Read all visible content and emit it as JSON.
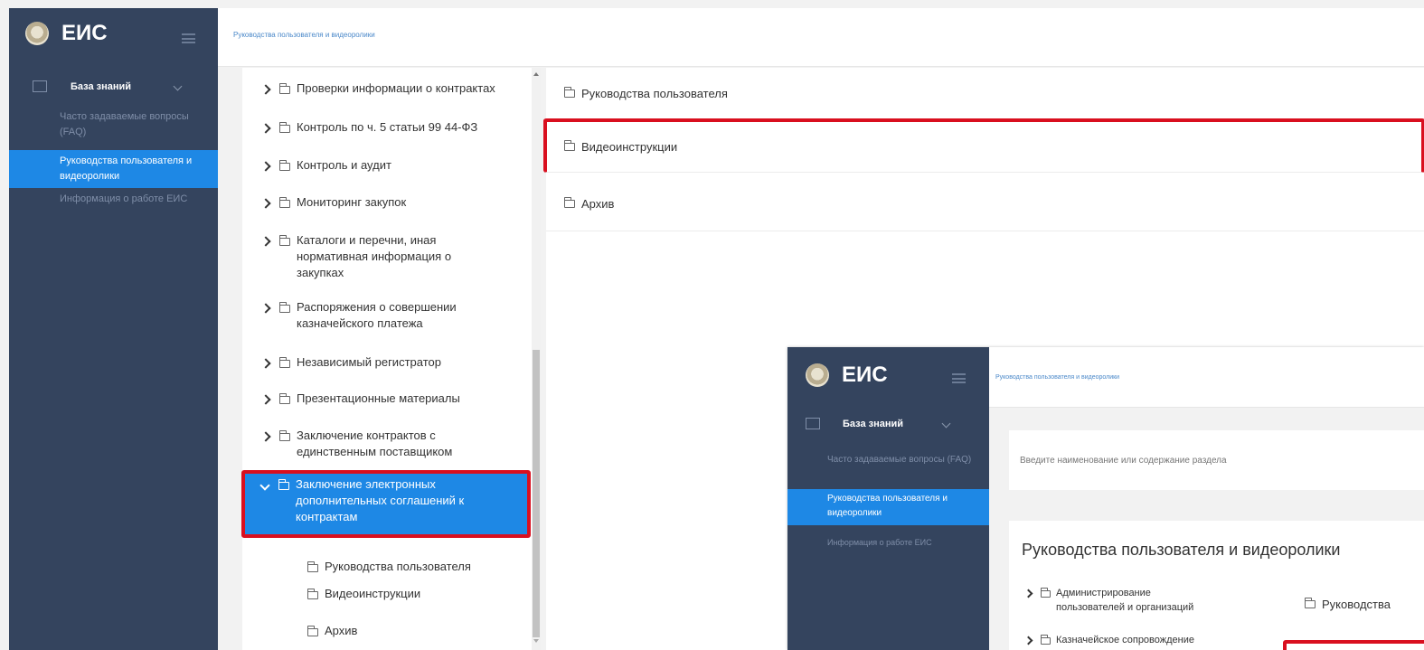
{
  "app": {
    "logo_text": "ЕИС",
    "breadcrumb": "Руководства пользователя и видеоролики"
  },
  "sidebar": {
    "section_label": "База знаний",
    "links": [
      {
        "label": "Часто задаваемые вопросы (FAQ)"
      },
      {
        "label": "Руководства пользователя и видеоролики"
      },
      {
        "label": "Информация о работе ЕИС"
      }
    ]
  },
  "tree": {
    "nodes": [
      {
        "label": "Проверки информации о контрактах"
      },
      {
        "label": "Контроль по ч. 5 статьи 99 44-ФЗ"
      },
      {
        "label": "Контроль и аудит"
      },
      {
        "label": "Мониторинг закупок"
      },
      {
        "label": "Каталоги и перечни, иная нормативная информация о закупках"
      },
      {
        "label": "Распоряжения о совершении казначейского платежа"
      },
      {
        "label": "Независимый регистратор"
      },
      {
        "label": "Презентационные материалы"
      },
      {
        "label": "Заключение контрактов с единственным поставщиком"
      },
      {
        "label": "Заключение электронных дополнительных соглашений к контрактам"
      }
    ],
    "children": [
      {
        "label": "Руководства пользователя"
      },
      {
        "label": "Видеоинструкции"
      },
      {
        "label": "Архив"
      }
    ]
  },
  "content": {
    "rows": [
      {
        "label": "Руководства пользователя"
      },
      {
        "label": "Видеоинструкции"
      },
      {
        "label": "Архив"
      }
    ]
  },
  "inset": {
    "logo_text": "ЕИС",
    "breadcrumb": "Руководства пользователя и видеоролики",
    "section_label": "База знаний",
    "links": [
      {
        "label": "Часто задаваемые вопросы (FAQ)"
      },
      {
        "label": "Руководства пользователя и видеоролики"
      },
      {
        "label": "Информация о работе ЕИС"
      }
    ],
    "search_placeholder": "Введите наименование или содержание раздела",
    "page_title": "Руководства пользователя и видеоролики",
    "tree_nodes": [
      {
        "label": "Администрирование пользователей и организаций"
      },
      {
        "label": "Казначейское сопровождение"
      }
    ],
    "right_item": "Руководства"
  }
}
